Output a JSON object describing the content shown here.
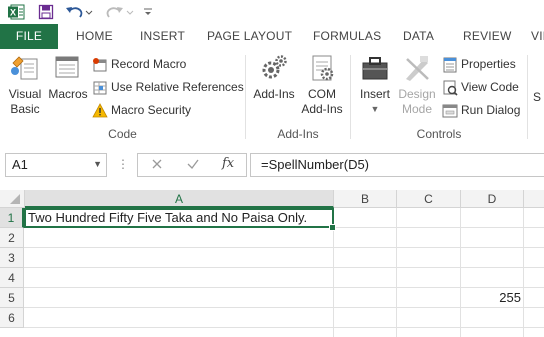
{
  "quick_access": {
    "icons": [
      "excel-logo",
      "save",
      "undo",
      "redo",
      "customize"
    ]
  },
  "tabs": [
    {
      "label": "FILE"
    },
    {
      "label": "HOME"
    },
    {
      "label": "INSERT"
    },
    {
      "label": "PAGE LAYOUT"
    },
    {
      "label": "FORMULAS"
    },
    {
      "label": "DATA"
    },
    {
      "label": "REVIEW"
    },
    {
      "label": "VIE"
    }
  ],
  "ribbon": {
    "code": {
      "visual_basic_line1": "Visual",
      "visual_basic_line2": "Basic",
      "macros": "Macros",
      "record_macro": "Record Macro",
      "use_relative": "Use Relative References",
      "macro_security": "Macro Security",
      "group_label": "Code"
    },
    "addins": {
      "addins": "Add-Ins",
      "com_line1": "COM",
      "com_line2": "Add-Ins",
      "group_label": "Add-Ins"
    },
    "controls": {
      "insert": "Insert",
      "design_line1": "Design",
      "design_line2": "Mode",
      "properties": "Properties",
      "view_code": "View Code",
      "run_dialog": "Run Dialog",
      "group_label": "Controls"
    },
    "next_group_letter": "S"
  },
  "formula_bar": {
    "name_box": "A1",
    "dots": "⋮",
    "fx": "fx",
    "formula": "=SpellNumber(D5)"
  },
  "sheet": {
    "columns": [
      "A",
      "B",
      "C",
      "D"
    ],
    "rows": [
      "1",
      "2",
      "3",
      "4",
      "5",
      "6"
    ],
    "cells": {
      "A1": "Two Hundred Fifty Five Taka and No Paisa Only.",
      "D5": "255"
    }
  },
  "colors": {
    "accent": "#217346"
  }
}
